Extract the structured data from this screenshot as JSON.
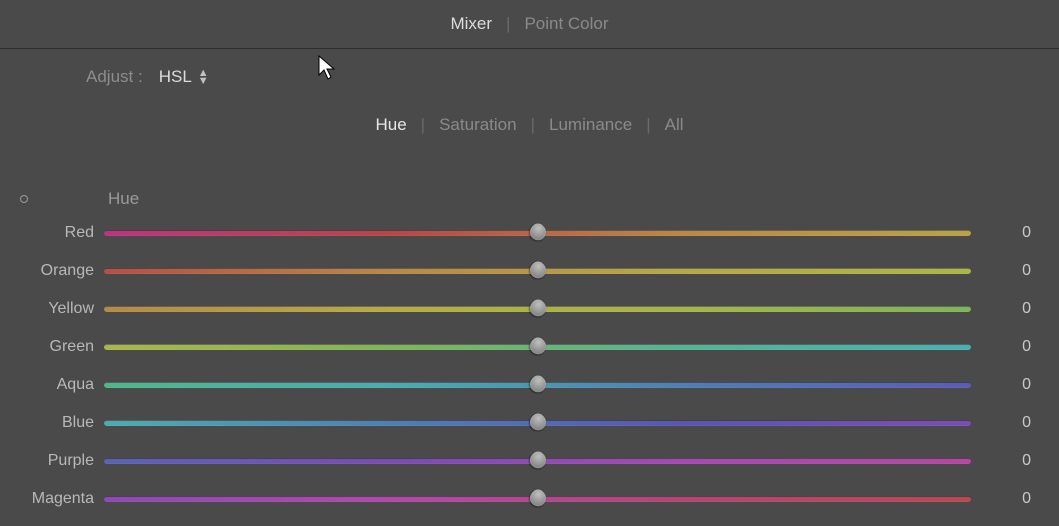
{
  "topTabs": {
    "mixer": "Mixer",
    "pointColor": "Point Color",
    "active": "mixer"
  },
  "adjust": {
    "label": "Adjust :",
    "value": "HSL"
  },
  "subTabs": {
    "hue": "Hue",
    "saturation": "Saturation",
    "luminance": "Luminance",
    "all": "All",
    "active": "hue"
  },
  "sectionTitle": "Hue",
  "sliders": [
    {
      "label": "Red",
      "value": "0",
      "grad": "g-red"
    },
    {
      "label": "Orange",
      "value": "0",
      "grad": "g-orange"
    },
    {
      "label": "Yellow",
      "value": "0",
      "grad": "g-yellow"
    },
    {
      "label": "Green",
      "value": "0",
      "grad": "g-green"
    },
    {
      "label": "Aqua",
      "value": "0",
      "grad": "g-aqua"
    },
    {
      "label": "Blue",
      "value": "0",
      "grad": "g-blue"
    },
    {
      "label": "Purple",
      "value": "0",
      "grad": "g-purple"
    },
    {
      "label": "Magenta",
      "value": "0",
      "grad": "g-magenta"
    }
  ]
}
